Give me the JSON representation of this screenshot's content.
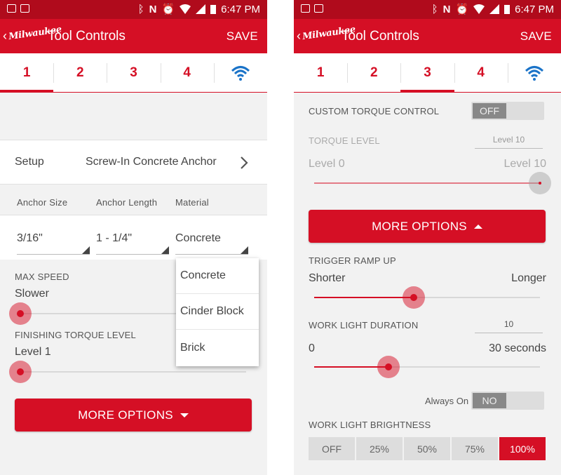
{
  "status": {
    "time": "6:47 PM"
  },
  "app": {
    "logo_text": "Milwaukee",
    "title": "Tool Controls",
    "save_label": "SAVE"
  },
  "tabs": [
    "1",
    "2",
    "3",
    "4"
  ],
  "left": {
    "setup_label": "Setup",
    "setup_value": "Screw-In Concrete Anchor",
    "col_labels": [
      "Anchor Size",
      "Anchor Length",
      "Material"
    ],
    "col_values": [
      "3/16\"",
      "1 - 1/4\"",
      "Concrete"
    ],
    "dropdown_options": [
      "Concrete",
      "Cinder Block",
      "Brick"
    ],
    "max_speed_label": "MAX SPEED",
    "max_speed_value": "Slower",
    "max_speed_level": 0.0,
    "finishing_label": "FINISHING TORQUE LEVEL",
    "finishing_value": "Level 1",
    "finishing_level": 0.0,
    "more_options_label": "MORE OPTIONS"
  },
  "right": {
    "custom_torque_label": "CUSTOM TORQUE CONTROL",
    "custom_torque_toggle": "OFF",
    "torque_level_label": "TORQUE LEVEL",
    "torque_level_value": "Level 10",
    "torque_min": "Level 0",
    "torque_max": "Level 10",
    "torque_level": 1.0,
    "more_options_label": "MORE OPTIONS",
    "trigger_label": "TRIGGER RAMP UP",
    "trigger_min": "Shorter",
    "trigger_max": "Longer",
    "trigger_level": 0.44,
    "worklight_label": "WORK LIGHT DURATION",
    "worklight_value": "10",
    "worklight_min": "0",
    "worklight_max": "30 seconds",
    "worklight_level": 0.33,
    "always_on_label": "Always On",
    "always_on_toggle": "NO",
    "brightness_label": "WORK LIGHT BRIGHTNESS",
    "brightness_options": [
      "OFF",
      "25%",
      "50%",
      "75%",
      "100%"
    ],
    "brightness_selected": "100%"
  },
  "colors": {
    "brand_red": "#d50f25",
    "status_red": "#b00b1c",
    "wifi_blue": "#1a73c8"
  }
}
